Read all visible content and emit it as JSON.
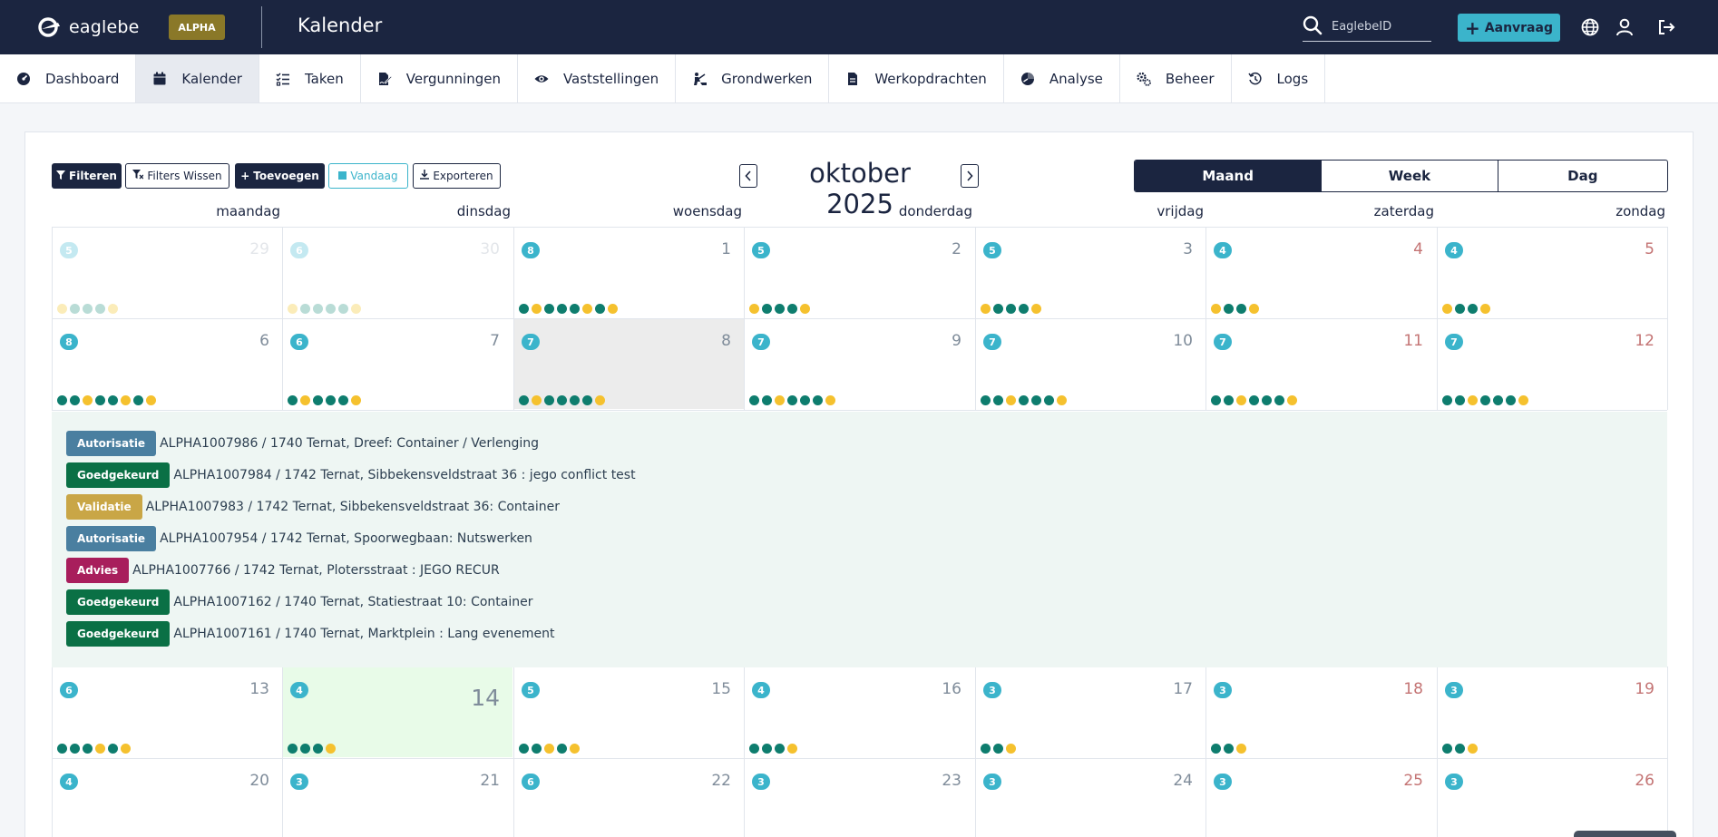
{
  "app": {
    "name": "eaglebe",
    "env_badge": "ALPHA",
    "page_title": "Kalender"
  },
  "search": {
    "placeholder": "EaglebeID"
  },
  "header": {
    "request_button": "Aanvraag"
  },
  "nav": [
    {
      "label": "Dashboard",
      "icon": "gauge-icon"
    },
    {
      "label": "Kalender",
      "icon": "calendar-icon",
      "active": true
    },
    {
      "label": "Taken",
      "icon": "tasks-icon"
    },
    {
      "label": "Vergunningen",
      "icon": "signature-icon"
    },
    {
      "label": "Vaststellingen",
      "icon": "eye-icon"
    },
    {
      "label": "Grondwerken",
      "icon": "digging-icon"
    },
    {
      "label": "Werkopdrachten",
      "icon": "document-icon"
    },
    {
      "label": "Analyse",
      "icon": "chart-icon"
    },
    {
      "label": "Beheer",
      "icon": "gears-icon"
    },
    {
      "label": "Logs",
      "icon": "history-icon"
    }
  ],
  "toolbar": {
    "filter": "Filteren",
    "clear_filters": "Filters Wissen",
    "add": "Toevoegen",
    "today": "Vandaag",
    "export": "Exporteren"
  },
  "calendar": {
    "month_title": "oktober 2025",
    "views": [
      "Maand",
      "Week",
      "Dag"
    ],
    "active_view": "Maand",
    "weekdays": [
      "maandag",
      "dinsdag",
      "woensdag",
      "donderdag",
      "vrijdag",
      "zaterdag",
      "zondag"
    ],
    "weeks": [
      [
        {
          "day": "29",
          "count": "5",
          "dim": true,
          "dots": [
            "y",
            "t",
            "t",
            "t",
            "y"
          ]
        },
        {
          "day": "30",
          "count": "6",
          "dim": true,
          "dots": [
            "y",
            "t",
            "t",
            "t",
            "t",
            "y"
          ]
        },
        {
          "day": "1",
          "count": "8",
          "dots": [
            "t",
            "y",
            "t",
            "t",
            "t",
            "y",
            "t",
            "y"
          ]
        },
        {
          "day": "2",
          "count": "5",
          "dots": [
            "y",
            "t",
            "t",
            "t",
            "y"
          ]
        },
        {
          "day": "3",
          "count": "5",
          "dots": [
            "y",
            "t",
            "t",
            "t",
            "y"
          ]
        },
        {
          "day": "4",
          "count": "4",
          "weekend": true,
          "dots": [
            "y",
            "t",
            "t",
            "y"
          ]
        },
        {
          "day": "5",
          "count": "4",
          "weekend": true,
          "dots": [
            "y",
            "t",
            "t",
            "y"
          ]
        }
      ],
      [
        {
          "day": "6",
          "count": "8",
          "dots": [
            "t",
            "t",
            "y",
            "t",
            "t",
            "y",
            "t",
            "y"
          ]
        },
        {
          "day": "7",
          "count": "6",
          "dots": [
            "t",
            "y",
            "t",
            "t",
            "t",
            "y"
          ]
        },
        {
          "day": "8",
          "count": "7",
          "selected": true,
          "dots": [
            "t",
            "y",
            "t",
            "t",
            "t",
            "t",
            "y"
          ]
        },
        {
          "day": "9",
          "count": "7",
          "dots": [
            "t",
            "t",
            "y",
            "t",
            "t",
            "t",
            "y"
          ]
        },
        {
          "day": "10",
          "count": "7",
          "dots": [
            "t",
            "t",
            "y",
            "t",
            "t",
            "t",
            "y"
          ]
        },
        {
          "day": "11",
          "count": "7",
          "weekend": true,
          "dots": [
            "t",
            "t",
            "y",
            "t",
            "t",
            "t",
            "y"
          ]
        },
        {
          "day": "12",
          "count": "7",
          "weekend": true,
          "dots": [
            "t",
            "t",
            "y",
            "t",
            "t",
            "t",
            "y"
          ]
        }
      ],
      [
        {
          "day": "13",
          "count": "6",
          "dots": [
            "t",
            "t",
            "t",
            "y",
            "t",
            "y"
          ]
        },
        {
          "day": "14",
          "count": "4",
          "today": true,
          "dots": [
            "t",
            "t",
            "t",
            "y"
          ]
        },
        {
          "day": "15",
          "count": "5",
          "dots": [
            "t",
            "t",
            "y",
            "t",
            "y"
          ]
        },
        {
          "day": "16",
          "count": "4",
          "dots": [
            "t",
            "t",
            "t",
            "y"
          ]
        },
        {
          "day": "17",
          "count": "3",
          "dots": [
            "t",
            "t",
            "y"
          ]
        },
        {
          "day": "18",
          "count": "3",
          "weekend": true,
          "dots": [
            "t",
            "t",
            "y"
          ]
        },
        {
          "day": "19",
          "count": "3",
          "weekend": true,
          "dots": [
            "t",
            "t",
            "y"
          ]
        }
      ],
      [
        {
          "day": "20",
          "count": "4",
          "dots": []
        },
        {
          "day": "21",
          "count": "3",
          "dots": []
        },
        {
          "day": "22",
          "count": "6",
          "dots": []
        },
        {
          "day": "23",
          "count": "3",
          "dots": []
        },
        {
          "day": "24",
          "count": "3",
          "dots": []
        },
        {
          "day": "25",
          "count": "3",
          "weekend": true,
          "dots": []
        },
        {
          "day": "26",
          "count": "3",
          "weekend": true,
          "dots": []
        }
      ]
    ],
    "dot_colors": {
      "t": "#0e7d6e",
      "y": "#f5c12e"
    },
    "dim_dot_colors": {
      "t": "#b9dcd6",
      "y": "#fbecb9"
    }
  },
  "events": [
    {
      "status": "Autorisatie",
      "color": "#4a7fa0",
      "text": "ALPHA1007986 / 1740 Ternat, Dreef: Container / Verlenging"
    },
    {
      "status": "Goedgekeurd",
      "color": "#0a7045",
      "text": "ALPHA1007984 / 1742 Ternat, Sibbekensveldstraat 36 : jego conflict test"
    },
    {
      "status": "Validatie",
      "color": "#c9a646",
      "text": "ALPHA1007983 / 1742 Ternat, Sibbekensveldstraat 36: Container"
    },
    {
      "status": "Autorisatie",
      "color": "#4a7fa0",
      "text": "ALPHA1007954 / 1742 Ternat, Spoorwegbaan: Nutswerken"
    },
    {
      "status": "Advies",
      "color": "#a81e5c",
      "text": "ALPHA1007766 / 1742 Ternat, Plotersstraat : JEGO RECUR"
    },
    {
      "status": "Goedgekeurd",
      "color": "#0a7045",
      "text": "ALPHA1007162 / 1740 Ternat, Statiestraat 10: Container"
    },
    {
      "status": "Goedgekeurd",
      "color": "#0a7045",
      "text": "ALPHA1007161 / 1740 Ternat, Marktplein : Lang evenement"
    }
  ]
}
